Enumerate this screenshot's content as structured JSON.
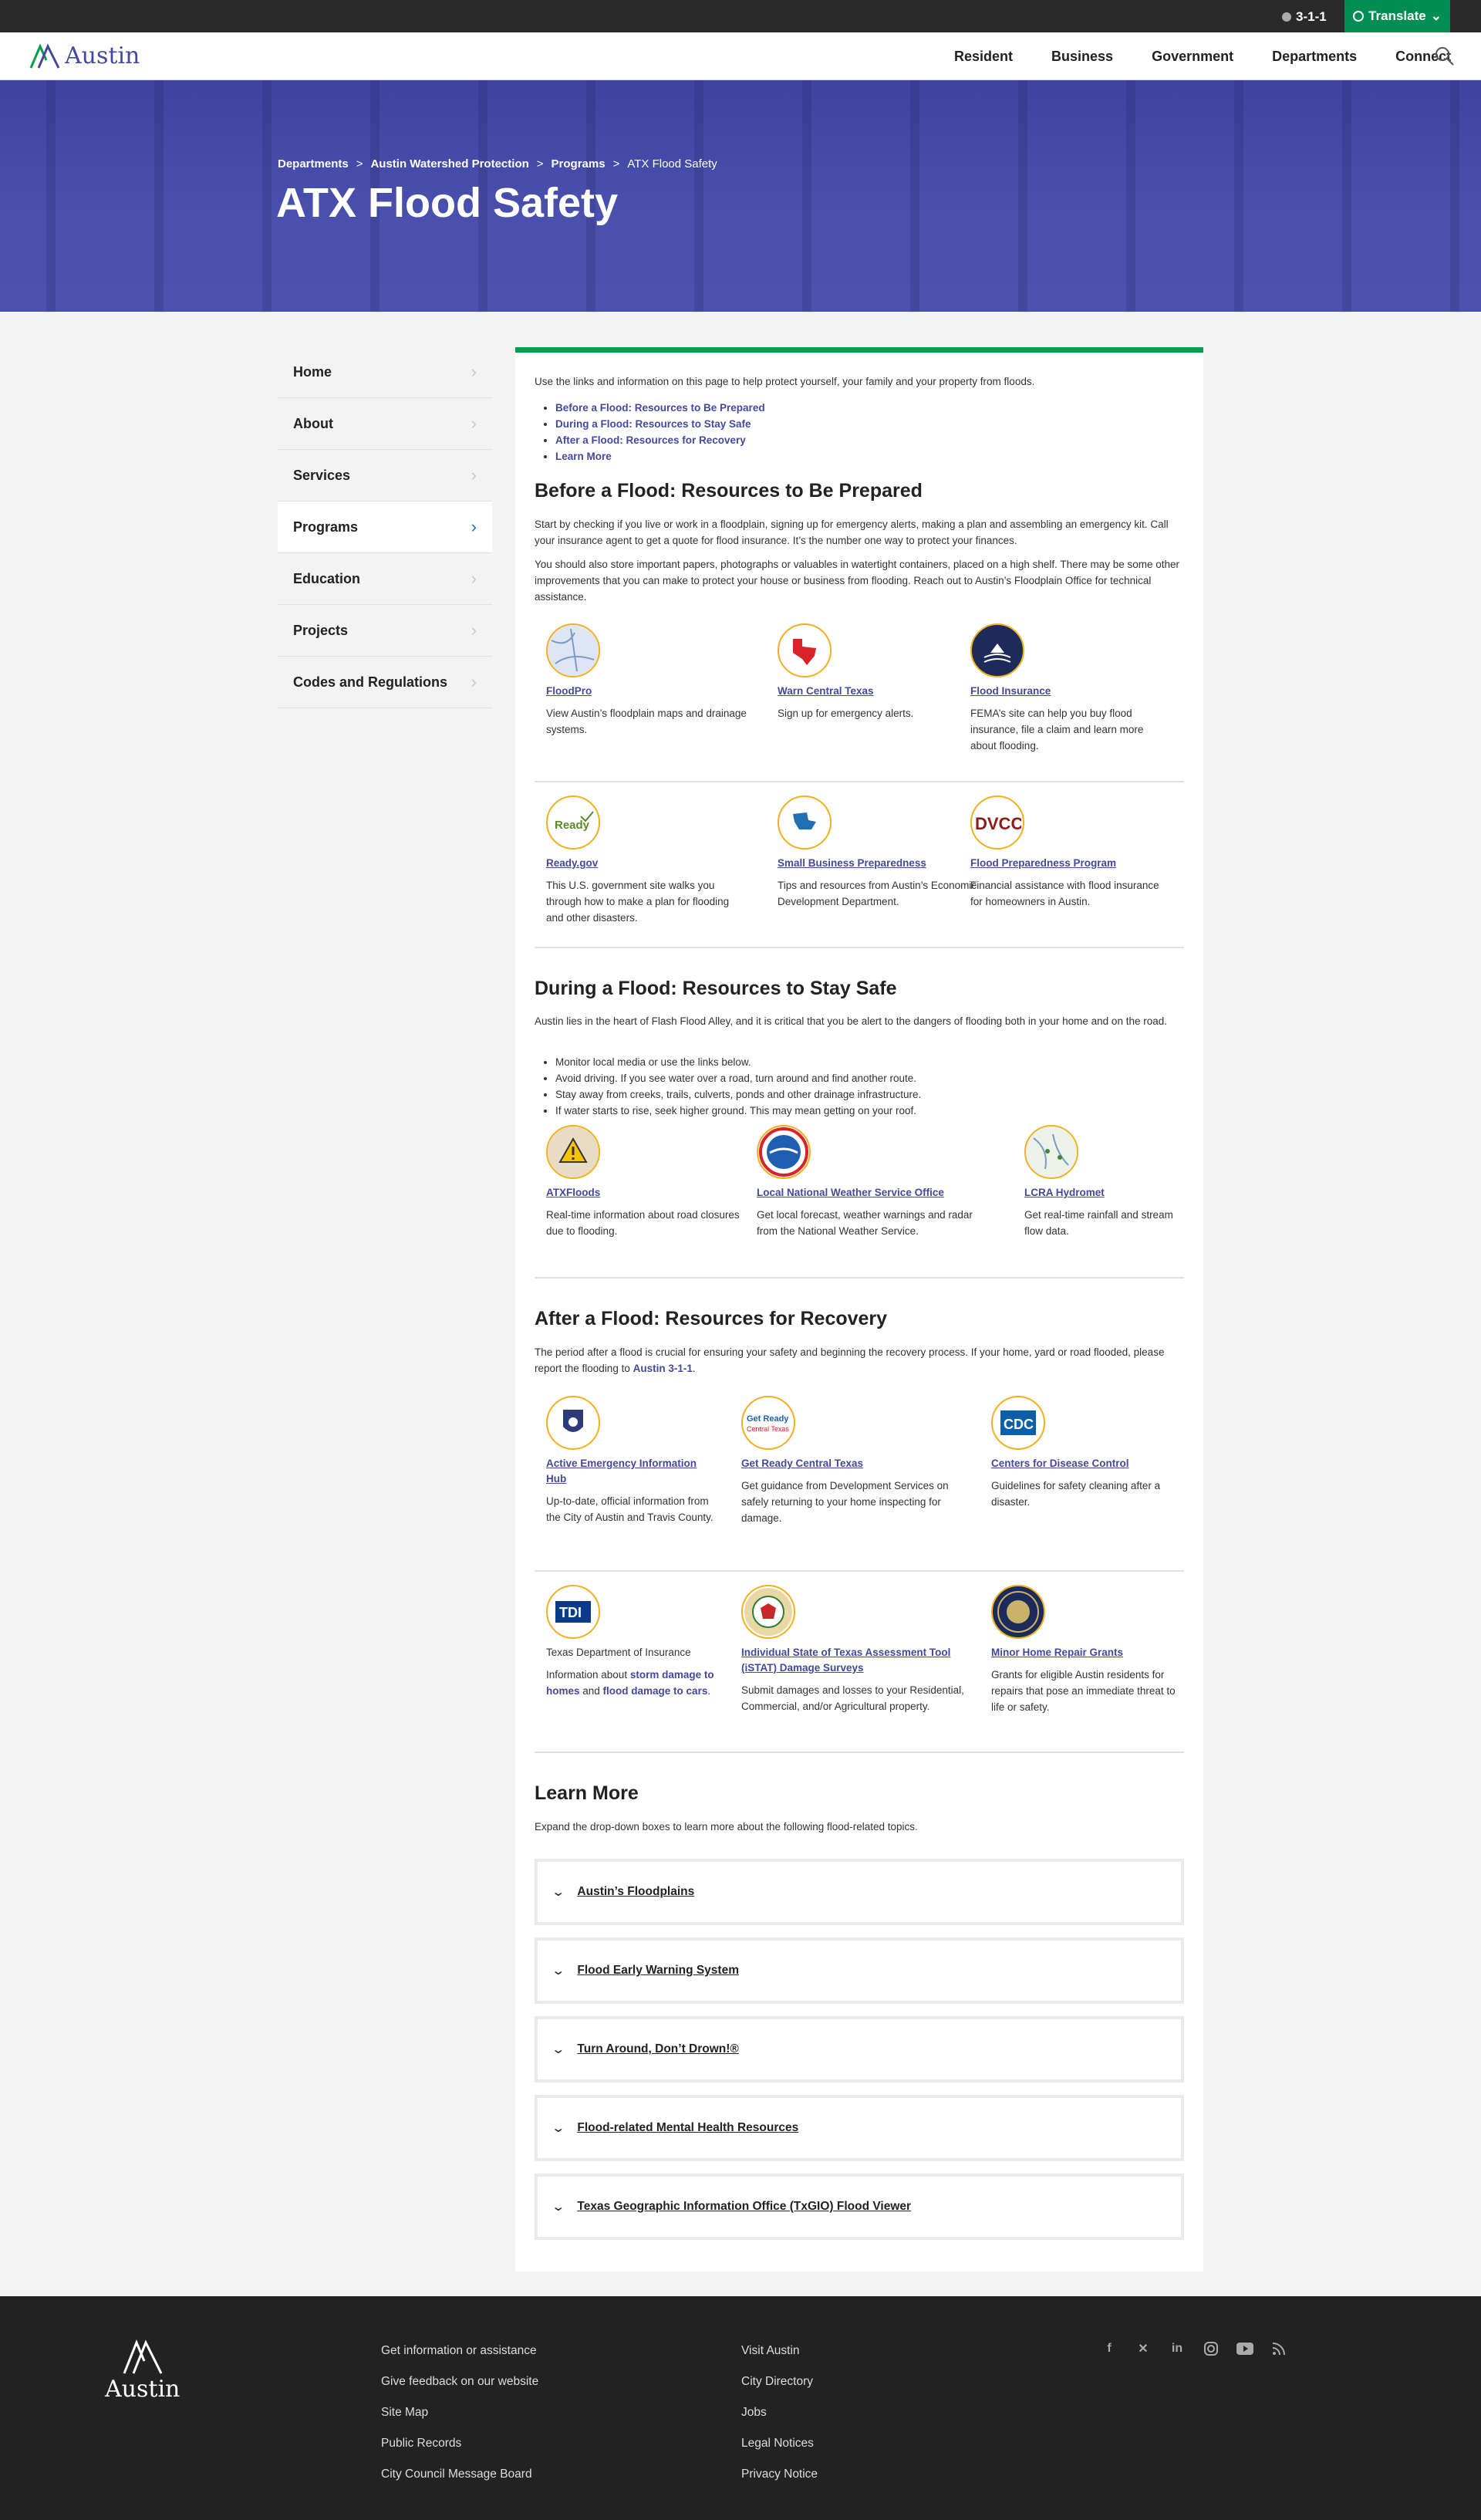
{
  "utility": {
    "phone": "3-1-1",
    "translate": "Translate"
  },
  "header": {
    "logo": "Austin",
    "nav": [
      "Resident",
      "Business",
      "Government",
      "Departments",
      "Connect"
    ]
  },
  "hero": {
    "breadcrumbs": [
      "Departments",
      "Austin Watershed Protection",
      "Programs",
      "ATX Flood Safety"
    ],
    "title": "ATX Flood Safety"
  },
  "sidebar": {
    "items": [
      {
        "label": "Home"
      },
      {
        "label": "About"
      },
      {
        "label": "Services"
      },
      {
        "label": "Programs",
        "active": true
      },
      {
        "label": "Education"
      },
      {
        "label": "Projects"
      },
      {
        "label": "Codes and Regulations"
      }
    ]
  },
  "main": {
    "intro": "Use the links and information on this page to help protect yourself, your family and your property from floods.",
    "jump_links": [
      "Before a Flood: Resources to Be Prepared",
      "During a Flood: Resources to Stay Safe",
      "After a Flood: Resources for Recovery",
      "Learn More"
    ],
    "before": {
      "heading": "Before a Flood: Resources to Be Prepared",
      "p1": "Start by checking if you live or work in a floodplain, signing up for emergency alerts, making a plan and assembling an emergency kit. Call your insurance agent to get a quote for flood insurance. It’s the number one way to protect your finances.",
      "p2": "You should also store important papers, photographs or valuables in watertight containers, placed on a high shelf. There may be some other improvements that you can make to protect your house or business from flooding. Reach out to Austin’s Floodplain Office for technical assistance.",
      "cards": [
        {
          "icon": "floodpro-map-icon",
          "title": "FloodPro",
          "desc": "View Austin’s floodplain maps and drainage systems."
        },
        {
          "icon": "warn-texas-icon",
          "title": "Warn Central Texas",
          "desc": "Sign up for emergency alerts."
        },
        {
          "icon": "national-flood-insurance-icon",
          "title": "Flood Insurance",
          "desc": "FEMA’s site can help you buy flood insurance, file a claim and learn more about flooding."
        },
        {
          "icon": "ready-gov-icon",
          "title": "Ready.gov",
          "desc": "This U.S. government site walks you through how to make a plan for flooding and other disasters."
        },
        {
          "icon": "economic-development-icon",
          "title": "Small Business Preparedness",
          "desc": "Tips and resources from Austin’s Economic Development Department."
        },
        {
          "icon": "dvcc-icon",
          "title": "Flood Preparedness Program",
          "desc": "Financial assistance with flood insurance for homeowners in Austin."
        }
      ]
    },
    "during": {
      "heading": "During a Flood: Resources to Stay Safe",
      "p1": "Austin lies in the heart of Flash Flood Alley, and it is critical that you be alert to the dangers of flooding both in your home and on the road.",
      "bullets": [
        "Monitor local media or use the links below.",
        "Avoid driving. If you see water over a road, turn around and find another route.",
        "Stay away from creeks, trails, culverts, ponds and other drainage infrastructure.",
        "If water starts to rise, seek higher ground. This may mean getting on your roof."
      ],
      "cards": [
        {
          "icon": "atxfloods-warning-icon",
          "title": "ATXFloods",
          "desc": "Real-time information about road closures due to flooding."
        },
        {
          "icon": "national-weather-service-icon",
          "title": "Local National Weather Service Office",
          "desc": "Get local forecast, weather warnings and radar from the National Weather Service."
        },
        {
          "icon": "lcra-hydromet-map-icon",
          "title": "LCRA Hydromet",
          "desc": "Get real-time rainfall and stream flow data."
        }
      ]
    },
    "after": {
      "heading": "After a Flood: Resources for Recovery",
      "p1_text": "The period after a flood is crucial for ensuring your safety and beginning the recovery process. If your home, yard or road flooded, please report the flooding to ",
      "p1_link": "Austin 3-1-1",
      "p1_end": ".",
      "cards": [
        {
          "icon": "emergency-hub-badge-icon",
          "title": "Active Emergency Information Hub",
          "desc": "Up-to-date, official information from the City of Austin and Travis County."
        },
        {
          "icon": "get-ready-central-texas-icon",
          "title": "Get Ready Central Texas",
          "desc": "Get guidance from Development Services on safely returning to your home inspecting for damage."
        },
        {
          "icon": "cdc-icon",
          "title": "Centers for Disease Control",
          "desc": "Guidelines for safety cleaning after a disaster."
        },
        {
          "icon": "tdi-icon",
          "title": "Texas Department of Insurance",
          "desc_a": "Information about ",
          "link1": "storm damage to homes",
          "desc_b": " and ",
          "link2": "flood damage to cars",
          "desc_c": "."
        },
        {
          "icon": "texas-emergency-management-icon",
          "title": "Individual State of Texas Assessment Tool (iSTAT) Damage Surveys",
          "desc": "Submit damages and losses to your Residential, Commercial, and/or Agricultural property."
        },
        {
          "icon": "city-seal-icon",
          "title": "Minor Home Repair Grants",
          "desc": "Grants for eligible Austin residents for repairs that pose an immediate threat to life or safety."
        }
      ]
    },
    "learn": {
      "heading": "Learn More",
      "p1": "Expand the drop-down boxes to learn more about the following flood-related topics.",
      "accordions": [
        "Austin’s Floodplains",
        "Flood Early Warning System",
        "Turn Around, Don’t Drown!®",
        "Flood-related Mental Health Resources",
        "Texas Geographic Information Office (TxGIO) Flood Viewer"
      ]
    }
  },
  "footer": {
    "logo": "Austin",
    "col1": [
      "Get information or assistance",
      "Give feedback on our website",
      "Site Map",
      "Public Records",
      "City Council Message Board"
    ],
    "col2": [
      "Visit Austin",
      "City Directory",
      "Jobs",
      "Legal Notices",
      "Privacy Notice"
    ],
    "social": [
      "facebook-icon",
      "x-icon",
      "linkedin-icon",
      "instagram-icon",
      "youtube-icon",
      "rss-icon"
    ]
  },
  "colors": {
    "brand": "#44499c",
    "accent": "#009f4d",
    "icon_ring": "#f2b01e"
  }
}
